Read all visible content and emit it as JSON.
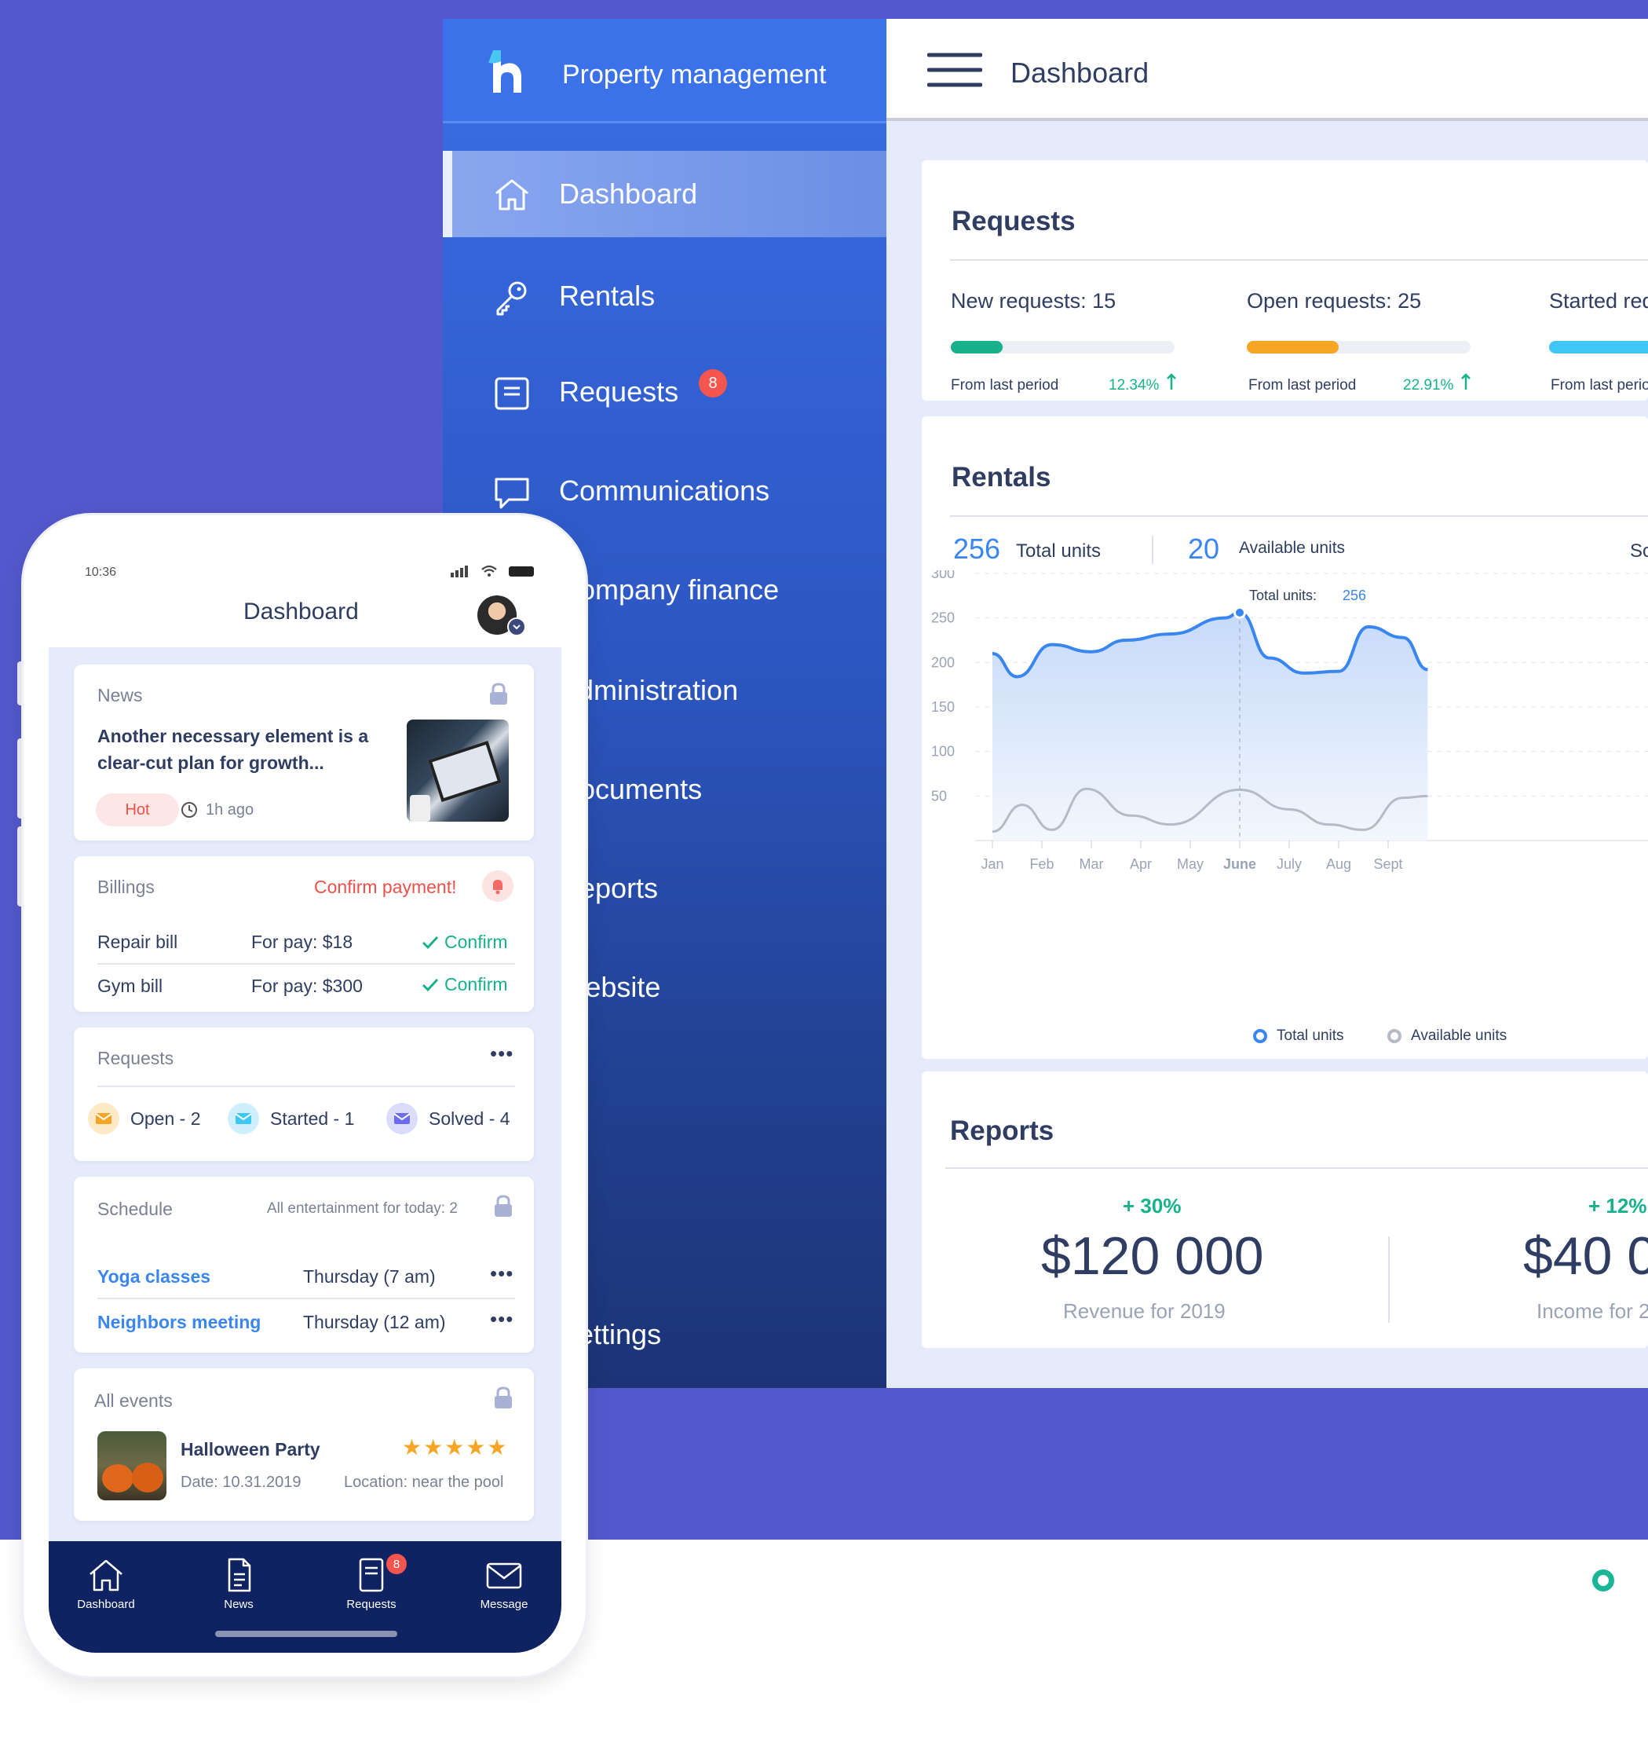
{
  "desktop": {
    "brand": "Property management",
    "header_title": "Dashboard",
    "nav": [
      {
        "label": "Dashboard",
        "icon": "home-icon",
        "active": true
      },
      {
        "label": "Rentals",
        "icon": "key-icon"
      },
      {
        "label": "Requests",
        "icon": "document-icon",
        "badge": "8"
      },
      {
        "label": "Communications",
        "icon": "chat-icon"
      },
      {
        "label": "Company finance",
        "icon": "finance-icon"
      },
      {
        "label": "Administration",
        "icon": "admin-icon"
      },
      {
        "label": "Documents",
        "icon": "documents-icon"
      },
      {
        "label": "Reports",
        "icon": "reports-icon"
      },
      {
        "label": "Website",
        "icon": "website-icon"
      },
      {
        "label": "Settings",
        "icon": "settings-icon"
      }
    ],
    "requests": {
      "title": "Requests",
      "items": [
        {
          "label": "New requests: 15",
          "from": "From last period",
          "pct": "12.34%",
          "color": "#17b28b",
          "fill": 0.23
        },
        {
          "label": "Open requests: 25",
          "from": "From last period",
          "pct": "22.91%",
          "color": "#f7a525",
          "fill": 0.41
        },
        {
          "label": "Started requests",
          "from": "From last period",
          "color": "#3ec6f4",
          "fill": 1.0
        }
      ]
    },
    "rentals": {
      "title": "Rentals",
      "total_num": "256",
      "total_label": "Total units",
      "available_num": "20",
      "available_label": "Available units",
      "cut_label": "Sc",
      "tooltip_label": "Total units:",
      "tooltip_value": "256",
      "legend_total": "Total units",
      "legend_available": "Available units"
    },
    "reports": {
      "title": "Reports",
      "items": [
        {
          "pct": "+ 30%",
          "value": "$120 000",
          "label": "Revenue for 2019"
        },
        {
          "pct": "+ 12%",
          "value": "$40 0",
          "label": "Income for 2"
        }
      ]
    }
  },
  "chart_data": {
    "type": "area",
    "categories": [
      "Jan",
      "Feb",
      "Mar",
      "Apr",
      "May",
      "June",
      "July",
      "Aug",
      "Sept"
    ],
    "highlight": "June",
    "ylim": [
      0,
      300
    ],
    "yticks": [
      50,
      100,
      150,
      200,
      250,
      300
    ],
    "series": [
      {
        "name": "Total units",
        "color": "#3a86f0",
        "values": [
          [
            0,
            210
          ],
          [
            0.5,
            184
          ],
          [
            1.2,
            220
          ],
          [
            2.0,
            212
          ],
          [
            2.7,
            225
          ],
          [
            3.6,
            232
          ],
          [
            4.7,
            250
          ],
          [
            5.0,
            256
          ],
          [
            5.6,
            205
          ],
          [
            6.3,
            188
          ],
          [
            7.0,
            190
          ],
          [
            7.6,
            240
          ],
          [
            8.3,
            228
          ],
          [
            8.8,
            192
          ]
        ]
      },
      {
        "name": "Available units",
        "color": "#b4bac6",
        "values": [
          [
            0,
            10
          ],
          [
            0.6,
            40
          ],
          [
            1.2,
            12
          ],
          [
            1.9,
            58
          ],
          [
            2.8,
            28
          ],
          [
            3.6,
            18
          ],
          [
            5.0,
            57
          ],
          [
            6.0,
            35
          ],
          [
            6.8,
            18
          ],
          [
            7.5,
            12
          ],
          [
            8.3,
            48
          ],
          [
            8.8,
            50
          ]
        ]
      }
    ]
  },
  "mobile": {
    "time": "10:36",
    "title": "Dashboard",
    "news": {
      "header": "News",
      "headline": "Another necessary element is a clear-cut plan for growth...",
      "tag": "Hot",
      "time": "1h ago"
    },
    "billings": {
      "header": "Billings",
      "alert": "Confirm payment!",
      "rows": [
        {
          "name": "Repair bill",
          "amount": "For pay: $18",
          "action": "Confirm"
        },
        {
          "name": "Gym bill",
          "amount": "For pay: $300",
          "action": "Confirm"
        }
      ]
    },
    "requests": {
      "header": "Requests",
      "open": "Open - 2",
      "started": "Started - 1",
      "solved": "Solved - 4"
    },
    "schedule": {
      "header": "Schedule",
      "summary": "All entertainment for today: 2",
      "rows": [
        {
          "name": "Yoga classes",
          "time": "Thursday (7 am)"
        },
        {
          "name": "Neighbors meeting",
          "time": "Thursday (12 am)"
        }
      ]
    },
    "events": {
      "header": "All events",
      "title": "Halloween Party",
      "date": "Date: 10.31.2019",
      "location": "Location: near the pool",
      "rating": 5
    },
    "tabs": [
      {
        "label": "Dashboard",
        "icon": "home-icon"
      },
      {
        "label": "News",
        "icon": "news-icon"
      },
      {
        "label": "Requests",
        "icon": "requests-icon",
        "badge": "8"
      },
      {
        "label": "Message",
        "icon": "mail-icon"
      }
    ]
  }
}
